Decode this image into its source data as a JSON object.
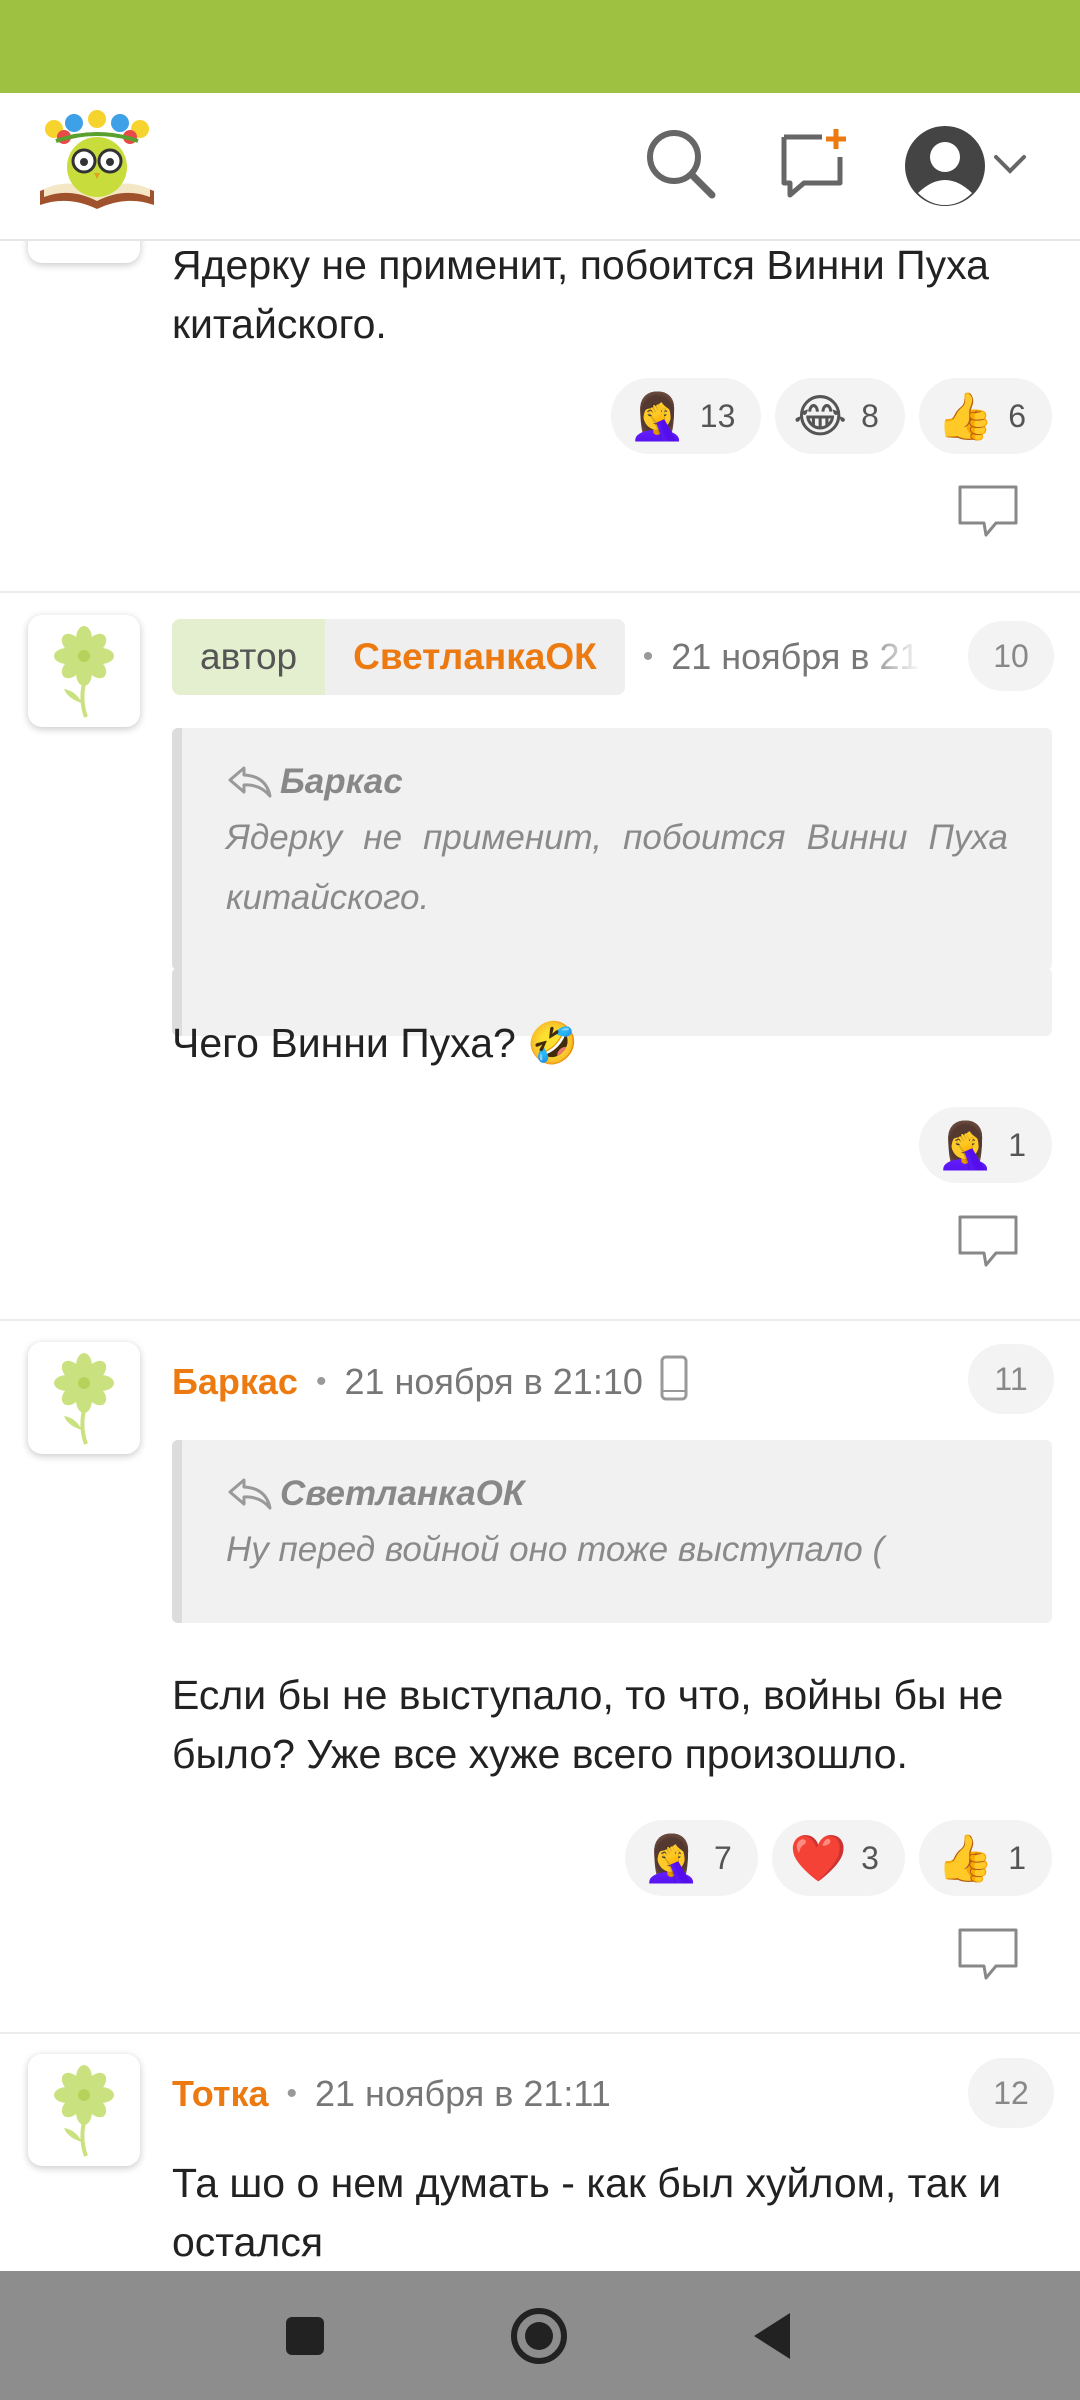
{
  "header": {
    "logo_icon": "owl-book-logo",
    "search_icon": "search-icon",
    "new_message_icon": "new-message-icon",
    "profile_icon": "user-avatar-icon"
  },
  "comments": [
    {
      "text": "Ядерку не применит, побоится Винни Пуха китайского.",
      "reactions": [
        {
          "emoji": "🤦‍♀️",
          "count": "13"
        },
        {
          "emoji": "😂",
          "count": "8"
        },
        {
          "emoji": "👍",
          "count": "6"
        }
      ]
    },
    {
      "author_label": "автор",
      "author": "СветланкаОК",
      "date": "21 ноября в 21",
      "number": "10",
      "quote_author": "Баркас",
      "quote_text": "Ядерку не применит, побоится Винни Пуха китайского.",
      "text": "Чего Винни Пуха? 🤣",
      "reactions": [
        {
          "emoji": "🤦‍♀️",
          "count": "1"
        }
      ]
    },
    {
      "author": "Баркас",
      "date": "21 ноября в 21:10",
      "number": "11",
      "quote_author": "СветланкаОК",
      "quote_text": "Ну перед войной оно тоже выступало (",
      "text": "Если бы не выступало, то что, войны бы не было? Уже все хуже всего произошло.",
      "reactions": [
        {
          "emoji": "🤦‍♀️",
          "count": "7"
        },
        {
          "emoji": "❤️",
          "count": "3"
        },
        {
          "emoji": "👍",
          "count": "1"
        }
      ]
    },
    {
      "author": "Тотка",
      "date": "21 ноября в 21:11",
      "number": "12",
      "text": "Та шо о нем думать - как был хуйлом, так и остался"
    }
  ],
  "colors": {
    "status_bar": "#9ec142",
    "username": "#ec7a10",
    "nav_bar": "#8d8d8d"
  }
}
